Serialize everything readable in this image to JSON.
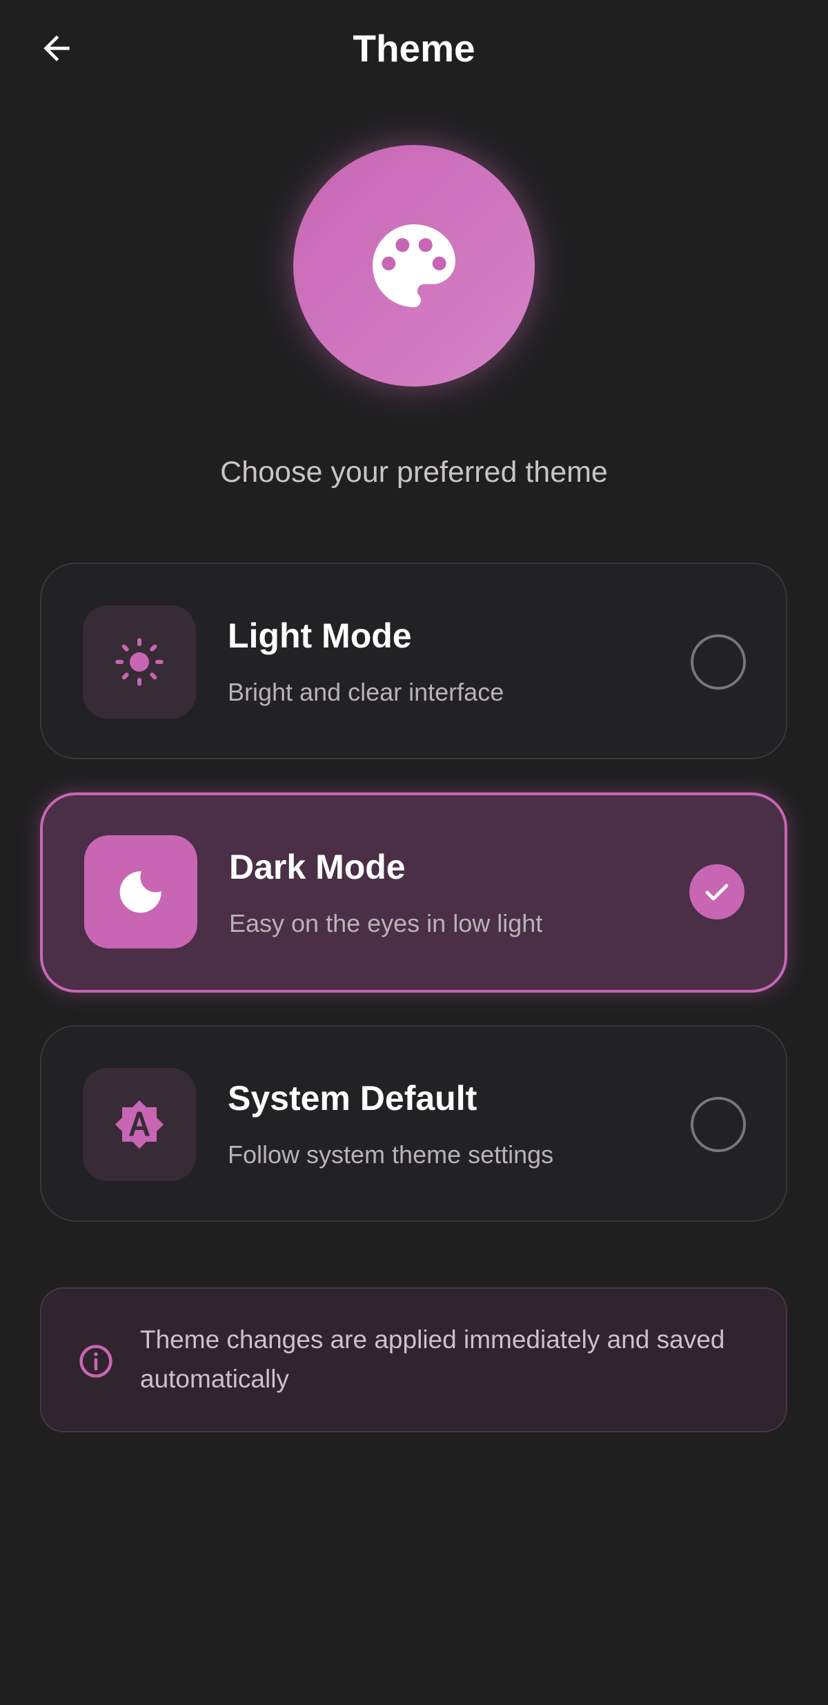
{
  "header": {
    "title": "Theme",
    "back_icon": "arrow-left-icon"
  },
  "hero": {
    "icon": "palette-icon"
  },
  "subtitle": "Choose your preferred theme",
  "options": [
    {
      "title": "Light Mode",
      "description": "Bright and clear interface",
      "icon": "sun-icon",
      "selected": false
    },
    {
      "title": "Dark Mode",
      "description": "Easy on the eyes in low light",
      "icon": "moon-icon",
      "selected": true
    },
    {
      "title": "System Default",
      "description": "Follow system theme settings",
      "icon": "auto-brightness-icon",
      "selected": false
    }
  ],
  "info": {
    "icon": "info-icon",
    "text": "Theme changes are applied immediately and saved automatically"
  },
  "colors": {
    "background": "#1f1f20",
    "accent": "#c866b4",
    "selected_card": "#4a2f47",
    "tile": "#372c35"
  }
}
